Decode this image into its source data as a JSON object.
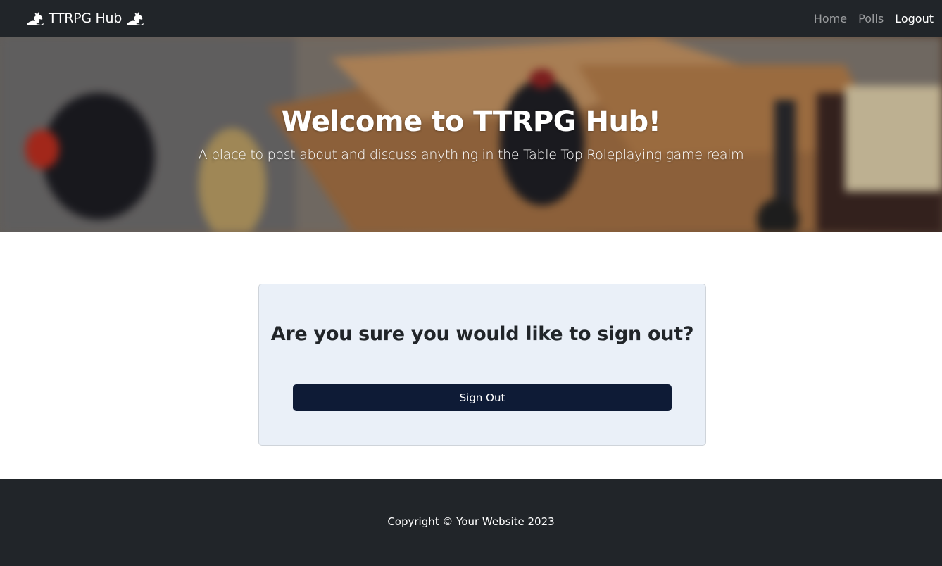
{
  "navbar": {
    "brand": "TTRPG Hub",
    "brand_icon": "dragon-icon",
    "links": [
      {
        "label": "Home"
      },
      {
        "label": "Polls"
      },
      {
        "label": "Logout"
      }
    ]
  },
  "hero": {
    "title": "Welcome to TTRPG Hub!",
    "subtitle": "A place to post about and discuss anything in the Table Top Roleplaying game realm"
  },
  "signout": {
    "question": "Are you sure you would like to sign out?",
    "button_label": "Sign Out"
  },
  "footer": {
    "copyright": "Copyright © Your Website 2023"
  },
  "colors": {
    "navbar_bg": "#212529",
    "card_bg": "#eaf0f8",
    "button_bg": "#0e1b36",
    "footer_bg": "#212529"
  }
}
